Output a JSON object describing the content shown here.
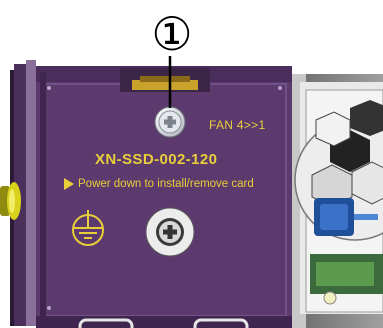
{
  "callout": {
    "number": "①"
  },
  "card": {
    "fan_label": "FAN 4>>1",
    "model": "XN-SSD-002-120",
    "warning": "Power down to install/remove card"
  },
  "icons": [
    "ground-symbol-icon",
    "warning-triangle-icon",
    "phillips-screw-icon"
  ],
  "colors": {
    "panel": "#5c3a6e",
    "panel_dark": "#3f2550",
    "label_yellow": "#e8cf3a",
    "latch_yellow": "#d8d21a",
    "connector_blue": "#1f4f9a"
  }
}
